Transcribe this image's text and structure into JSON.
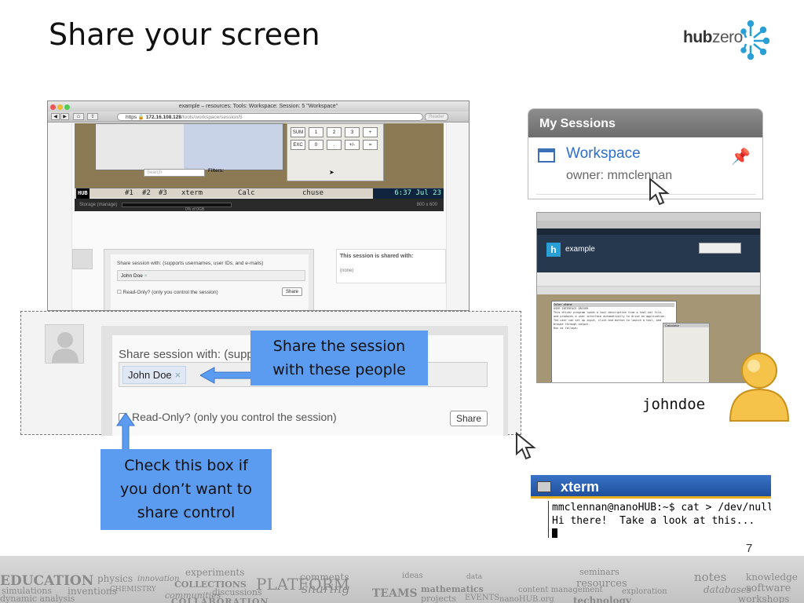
{
  "slide": {
    "title": "Share your screen",
    "page_number": "7",
    "logo": {
      "bold": "hub",
      "light": "zero"
    }
  },
  "browser": {
    "window_title": "example – resources: Tools: Workspace: Session: 5 \"Workspace\"",
    "url_prefix": "https",
    "url_host": "172.16.108.128",
    "url_path": "/tools/workspace/session/5",
    "reader_label": "Reader",
    "calculator_keys": [
      "SUM",
      "1",
      "2",
      "3",
      "+",
      "EXC",
      "0",
      ".",
      "+/-",
      "="
    ],
    "search_placeholder": "Search",
    "filters_label": "Filters:",
    "taskbar": {
      "hub": "HUB",
      "tab1": "#1",
      "tab2": "#2",
      "tab3": "#3",
      "xterm": "xterm",
      "calc": "Calc",
      "chuse": "chuse",
      "clock": "6:37 Jul 23"
    },
    "storage_label": "Storage (manage)",
    "storage_pct": "0% of 0GB",
    "screen_size": "800 x 600",
    "share_label": "Share session with: (supports usernames, user IDs, and e-mails)",
    "share_token": "John Doe",
    "readonly_label": "Read-Only? (only you control the session)",
    "share_button": "Share",
    "shared_with_title": "This session is shared with:",
    "shared_with_value": "(none)"
  },
  "zoom": {
    "share_label": "Share session with: (suppor",
    "token": "John Doe",
    "token_remove": "×",
    "readonly_label": "Read-Only? (only you control the session)",
    "share_button": "Share"
  },
  "callouts": {
    "share_people": [
      "Share the session",
      "with these people"
    ],
    "check_box": [
      "Check this box if",
      "you don’t want to",
      "share control"
    ]
  },
  "sessions": {
    "header": "My Sessions",
    "name": "Workspace",
    "owner": "owner: mmclennan"
  },
  "mini_browser": {
    "brand": "example",
    "brand_letter": "h",
    "terminal_title": "Color xterm",
    "terminal_lines": [
      "USER INTERFACE DRIVER",
      "This driver program loads a tool description from a tool.xml file,",
      "and produces a user interface automatically to drive an application.",
      "The user can set up input, click and button to launch a tool, and",
      "browse through output.",
      "Run as follows:"
    ],
    "calc_title": "Calculator"
  },
  "johndoe_label": "johndoe",
  "xterm": {
    "title": "xterm",
    "line1": "mmclennan@nanoHUB:~$ cat > /dev/null",
    "line2": "Hi there!  Take a look at this..."
  },
  "footer_words": [
    "EDUCATION",
    "simulations",
    "dynamic analysis",
    "physics",
    "innovation",
    "inventions",
    "CHEMISTRY",
    "experiments",
    "COLLECTIONS",
    "communities",
    "discussions",
    "PLATFORM",
    "comments",
    "sharing",
    "TEAMS",
    "ideas",
    "mathematics",
    "projects",
    "EVENTS",
    "data",
    "seminars",
    "resources",
    "content management",
    "exploration",
    "nanoHUB.org",
    "technology",
    "notes",
    "knowledge",
    "databases",
    "software",
    "workshops",
    "COLLABORATION"
  ],
  "colors": {
    "callout_blue": "#5b9bf0",
    "link_blue": "#2f6fc9",
    "xterm_bar": "#2d62b5"
  }
}
